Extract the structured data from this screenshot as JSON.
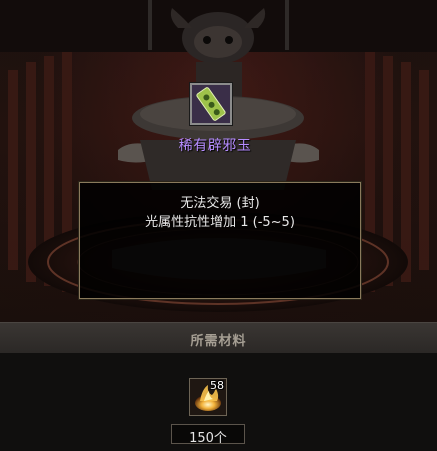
{
  "item": {
    "name": "稀有辟邪玉",
    "name_color": "#b58cff",
    "icon": "green-jade-talisman-icon"
  },
  "tooltip": {
    "lines": [
      "无法交易 (封)",
      "光属性抗性增加 1 (-5~5)"
    ]
  },
  "materials": {
    "header": "所需材料",
    "items": [
      {
        "icon": "glowing-flame-orb-icon",
        "stack_count": "58",
        "required": "150个"
      }
    ]
  }
}
